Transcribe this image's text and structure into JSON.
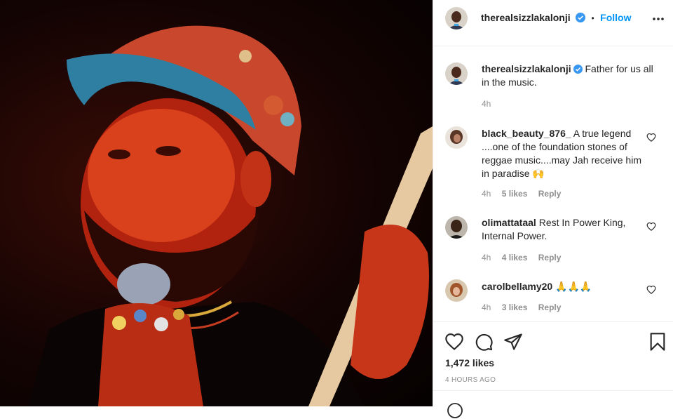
{
  "post": {
    "image_alt": "Man in colorful beaded cap holding a microphone",
    "author": "therealsizzlakalonji",
    "follow_separator": "•",
    "follow_label": "Follow",
    "caption": {
      "username": "therealsizzlakalonji",
      "text": "Father for us all in the music.",
      "time": "4h"
    },
    "comments": [
      {
        "username": "black_beauty_876_",
        "text": "A true legend ....one of the foundation stones of reggae music....may Jah receive him in paradise",
        "emoji": "🙌",
        "time": "4h",
        "likes": "5 likes",
        "reply": "Reply"
      },
      {
        "username": "olimattataal",
        "text": "Rest In Power King, Internal Power.",
        "emoji": "",
        "time": "4h",
        "likes": "4 likes",
        "reply": "Reply"
      },
      {
        "username": "carolbellamy20",
        "text": "",
        "emoji": "🙏🙏🙏",
        "time": "4h",
        "likes": "3 likes",
        "reply": "Reply"
      }
    ],
    "like_count": "1,472 likes",
    "posted": "4 HOURS AGO"
  },
  "icons": {
    "verified": "verified-badge-icon",
    "more": "more-options-icon",
    "like": "heart-icon",
    "comment": "comment-icon",
    "share": "share-icon",
    "save": "bookmark-icon"
  },
  "colors": {
    "link": "#0095f6",
    "verified": "#3897f0",
    "muted": "#8e8e8e",
    "text": "#262626"
  }
}
